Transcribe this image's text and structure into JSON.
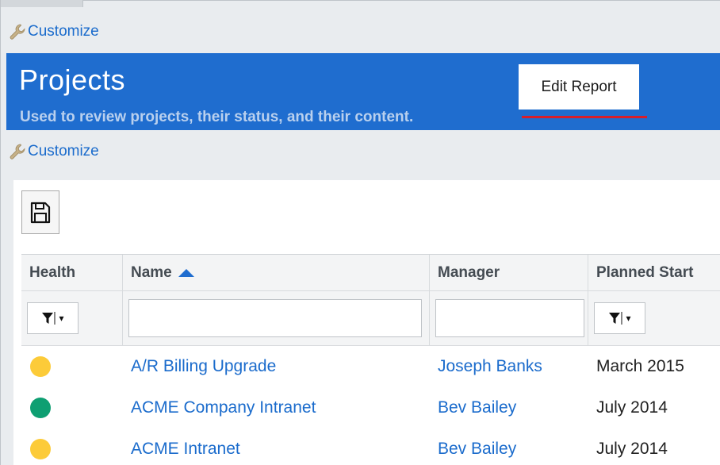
{
  "customize_label": "Customize",
  "header": {
    "title": "Projects",
    "subtitle": "Used to review projects, their status, and their content.",
    "edit_report_label": "Edit Report"
  },
  "toolbar": {
    "save_icon": "floppy-disk-icon"
  },
  "grid": {
    "columns": {
      "health": "Health",
      "name": "Name",
      "manager": "Manager",
      "planned_start": "Planned Start"
    },
    "sort": {
      "column": "name",
      "direction": "ascending"
    },
    "filters": {
      "name_value": "",
      "manager_value": ""
    },
    "rows": [
      {
        "health": "yellow",
        "name": "A/R Billing Upgrade",
        "manager": "Joseph Banks",
        "planned_start": "March 2015"
      },
      {
        "health": "green",
        "name": "ACME Company Intranet",
        "manager": "Bev Bailey",
        "planned_start": "July 2014"
      },
      {
        "health": "yellow",
        "name": "ACME Intranet",
        "manager": "Bev Bailey",
        "planned_start": "July 2014"
      }
    ]
  },
  "colors": {
    "banner": "#1f6dcf",
    "link": "#1a6bcc",
    "health_yellow": "#fccb39",
    "health_green": "#0e9f72",
    "underline": "#d81e2a"
  }
}
